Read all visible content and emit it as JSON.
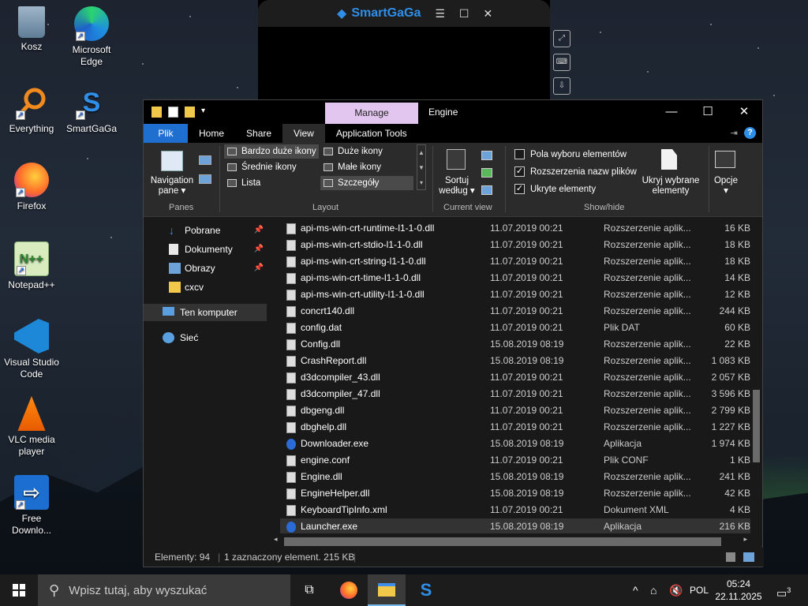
{
  "desktop": {
    "icons": [
      {
        "label": "Kosz",
        "icon": "recycle-bin-icon"
      },
      {
        "label": "Microsoft Edge",
        "icon": "edge-icon"
      },
      {
        "label": "Everything",
        "icon": "everything-search-icon"
      },
      {
        "label": "SmartGaGa",
        "icon": "smartgaga-icon"
      },
      {
        "label": "Firefox",
        "icon": "firefox-icon"
      },
      {
        "label": "Notepad++",
        "icon": "notepadpp-icon"
      },
      {
        "label": "Visual Studio Code",
        "icon": "vscode-icon"
      },
      {
        "label": "VLC media player",
        "icon": "vlc-icon"
      },
      {
        "label": "Free Downlo...",
        "icon": "free-download-manager-icon"
      }
    ]
  },
  "smartgaga": {
    "title": "SmartGaGa",
    "controls": [
      "☰",
      "☐",
      "✕"
    ]
  },
  "explorer": {
    "manage_tab": "Manage",
    "title": "Engine",
    "controls": {
      "min": "—",
      "max": "☐",
      "close": "✕"
    },
    "tabs": [
      "Plik",
      "Home",
      "Share",
      "View",
      "Application Tools"
    ],
    "ribbon": {
      "panes": {
        "nav_pane": "Navigation",
        "nav_pane2": "pane ▾",
        "label": "Panes"
      },
      "layout": {
        "items": [
          "Bardzo duże ikony",
          "Duże ikony",
          "Średnie ikony",
          "Małe ikony",
          "Lista",
          "Szczegóły"
        ],
        "label": "Layout"
      },
      "current_view": {
        "sort": "Sortuj",
        "sort2": "według ▾",
        "label": "Current view"
      },
      "show_hide": {
        "checkboxes": [
          {
            "label": "Pola wyboru elementów",
            "checked": false
          },
          {
            "label": "Rozszerzenia nazw plików",
            "checked": true
          },
          {
            "label": "Ukryte elementy",
            "checked": true
          }
        ],
        "hide_selected": "Ukryj wybrane",
        "hide_selected2": "elementy",
        "label": "Show/hide"
      },
      "options": {
        "label": "Opcje",
        "arrow": "▾"
      }
    },
    "nav": [
      {
        "label": "Pobrane",
        "icon": "download-icon",
        "pinned": true
      },
      {
        "label": "Dokumenty",
        "icon": "documents-icon",
        "pinned": true
      },
      {
        "label": "Obrazy",
        "icon": "pictures-icon",
        "pinned": true
      },
      {
        "label": "cxcv",
        "icon": "folder-icon",
        "pinned": false
      },
      {
        "label": "Ten komputer",
        "icon": "computer-icon",
        "pinned": false
      },
      {
        "label": "Sieć",
        "icon": "network-icon",
        "pinned": false
      }
    ],
    "files": [
      {
        "name": "api-ms-win-crt-runtime-l1-1-0.dll",
        "date": "11.07.2019 00:21",
        "type": "Rozszerzenie aplik...",
        "size": "16 KB",
        "exe": false
      },
      {
        "name": "api-ms-win-crt-stdio-l1-1-0.dll",
        "date": "11.07.2019 00:21",
        "type": "Rozszerzenie aplik...",
        "size": "18 KB",
        "exe": false
      },
      {
        "name": "api-ms-win-crt-string-l1-1-0.dll",
        "date": "11.07.2019 00:21",
        "type": "Rozszerzenie aplik...",
        "size": "18 KB",
        "exe": false
      },
      {
        "name": "api-ms-win-crt-time-l1-1-0.dll",
        "date": "11.07.2019 00:21",
        "type": "Rozszerzenie aplik...",
        "size": "14 KB",
        "exe": false
      },
      {
        "name": "api-ms-win-crt-utility-l1-1-0.dll",
        "date": "11.07.2019 00:21",
        "type": "Rozszerzenie aplik...",
        "size": "12 KB",
        "exe": false
      },
      {
        "name": "concrt140.dll",
        "date": "11.07.2019 00:21",
        "type": "Rozszerzenie aplik...",
        "size": "244 KB",
        "exe": false
      },
      {
        "name": "config.dat",
        "date": "11.07.2019 00:21",
        "type": "Plik DAT",
        "size": "60 KB",
        "exe": false
      },
      {
        "name": "Config.dll",
        "date": "15.08.2019 08:19",
        "type": "Rozszerzenie aplik...",
        "size": "22 KB",
        "exe": false
      },
      {
        "name": "CrashReport.dll",
        "date": "15.08.2019 08:19",
        "type": "Rozszerzenie aplik...",
        "size": "1 083 KB",
        "exe": false
      },
      {
        "name": "d3dcompiler_43.dll",
        "date": "11.07.2019 00:21",
        "type": "Rozszerzenie aplik...",
        "size": "2 057 KB",
        "exe": false
      },
      {
        "name": "d3dcompiler_47.dll",
        "date": "11.07.2019 00:21",
        "type": "Rozszerzenie aplik...",
        "size": "3 596 KB",
        "exe": false
      },
      {
        "name": "dbgeng.dll",
        "date": "11.07.2019 00:21",
        "type": "Rozszerzenie aplik...",
        "size": "2 799 KB",
        "exe": false
      },
      {
        "name": "dbghelp.dll",
        "date": "11.07.2019 00:21",
        "type": "Rozszerzenie aplik...",
        "size": "1 227 KB",
        "exe": false
      },
      {
        "name": "Downloader.exe",
        "date": "15.08.2019 08:19",
        "type": "Aplikacja",
        "size": "1 974 KB",
        "exe": true
      },
      {
        "name": "engine.conf",
        "date": "11.07.2019 00:21",
        "type": "Plik CONF",
        "size": "1 KB",
        "exe": false
      },
      {
        "name": "Engine.dll",
        "date": "15.08.2019 08:19",
        "type": "Rozszerzenie aplik...",
        "size": "241 KB",
        "exe": false
      },
      {
        "name": "EngineHelper.dll",
        "date": "15.08.2019 08:19",
        "type": "Rozszerzenie aplik...",
        "size": "42 KB",
        "exe": false
      },
      {
        "name": "KeyboardTipInfo.xml",
        "date": "11.07.2019 00:21",
        "type": "Dokument XML",
        "size": "4 KB",
        "exe": false
      },
      {
        "name": "Launcher.exe",
        "date": "15.08.2019 08:19",
        "type": "Aplikacja",
        "size": "216 KB",
        "exe": true,
        "selected": true
      }
    ],
    "status": {
      "count": "Elementy: 94",
      "selected": "1 zaznaczony element. 215 KB"
    }
  },
  "taskbar": {
    "search_placeholder": "Wpisz tutaj, aby wyszukać",
    "lang": "POL",
    "time": "05:24",
    "date": "22.11.2025",
    "notifications": "3"
  },
  "colors": {
    "accent": "#1e6fd0",
    "manage": "#e2c6f0",
    "selection": "#333333"
  }
}
